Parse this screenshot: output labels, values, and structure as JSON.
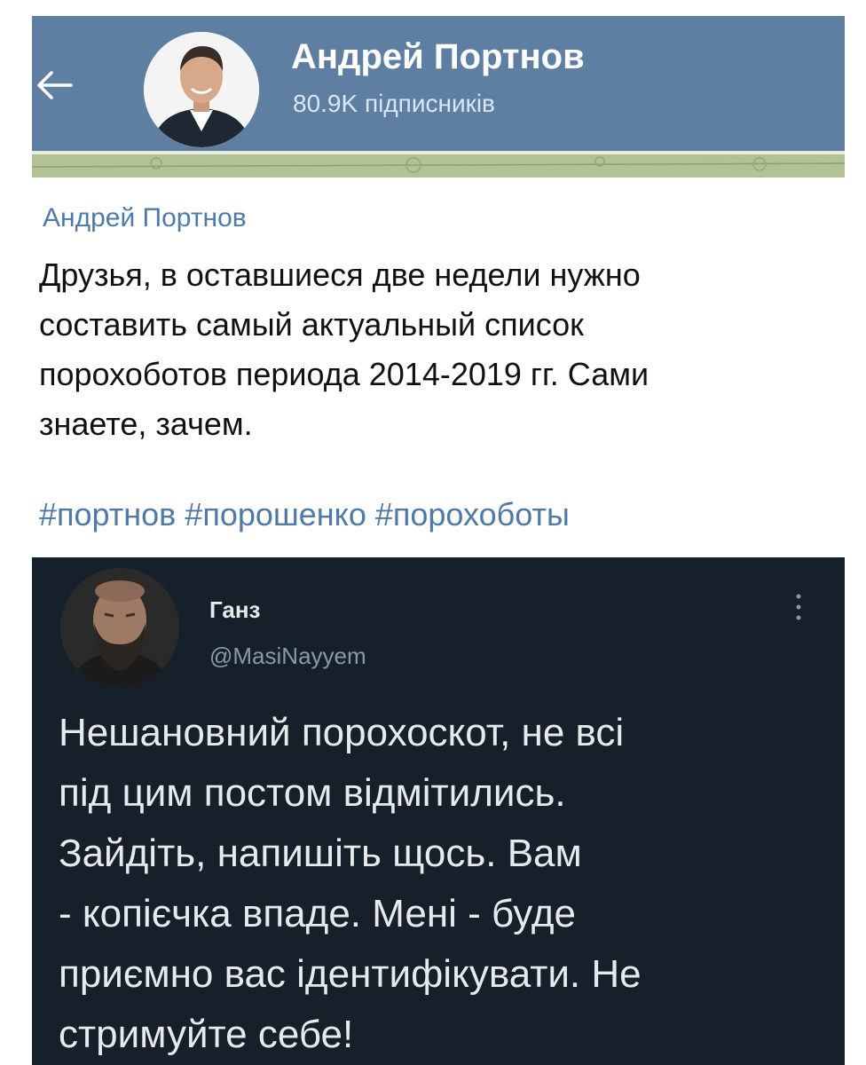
{
  "telegram": {
    "channel_title": "Андрей Портнов",
    "subscribers": "80.9K підписників",
    "message": {
      "author": "Андрей Портнов",
      "lines": [
        "Друзья, в оставшиеся две недели нужно",
        "составить самый актуальный список",
        "порохоботов периода 2014-2019 гг. Сами",
        "знаете, зачем."
      ],
      "hashtags": [
        "#портнов",
        "#порошенко",
        "#порохоботы"
      ]
    }
  },
  "tweet": {
    "name": "Ганз",
    "handle": "@MasiNayyem",
    "lines": [
      "Нешановний порохоскот, не всі",
      "під цим постом відмітились.",
      "Зайдіть, напишіть щось. Вам",
      "- копієчка впаде. Мені - буде",
      "приємно вас ідентифікувати. Не",
      "стримуйте себе!"
    ]
  },
  "colors": {
    "telegram_header": "#5f7fa2",
    "telegram_link": "#4f7aa8",
    "tweet_background": "#15202b",
    "tweet_text": "#e7e9ea",
    "tweet_handle": "#8b98a5"
  },
  "icons": {
    "back": "arrow-left-icon",
    "menu": "more-vertical-icon"
  }
}
